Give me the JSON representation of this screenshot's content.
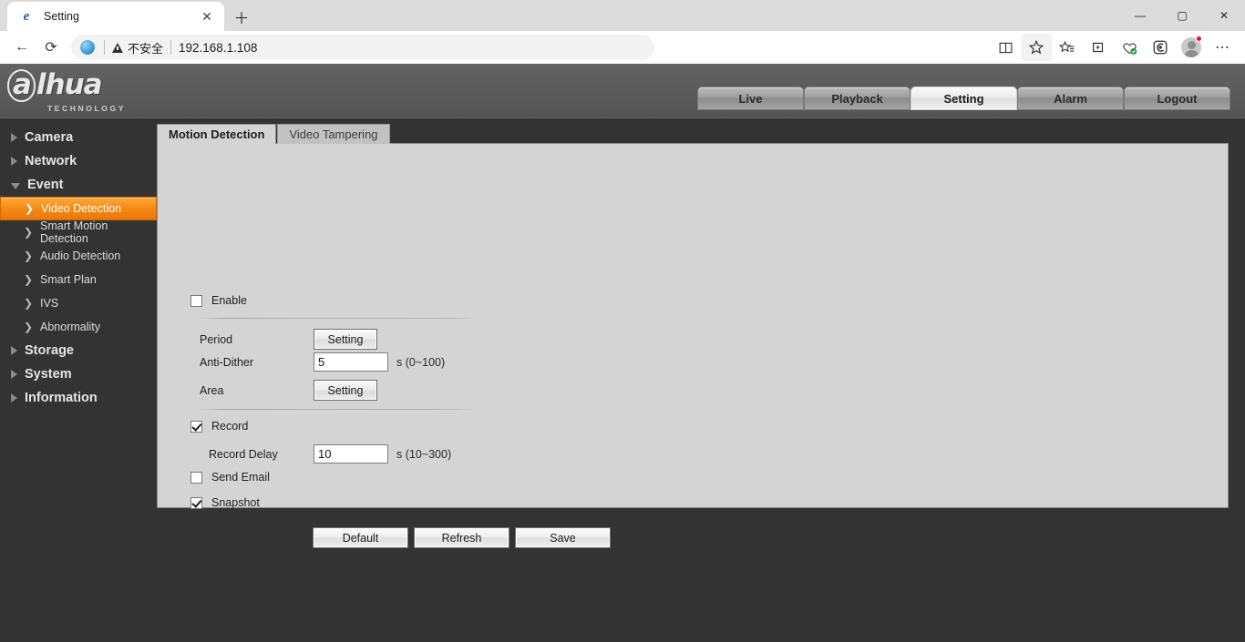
{
  "browser": {
    "tab": {
      "title": "Setting",
      "favicon_icon": "edge-e-icon",
      "close_icon": "✕"
    },
    "newtab_icon": "＋",
    "nav": {
      "back_icon": "←",
      "reload_icon": "⟳"
    },
    "address": {
      "globe_icon": "globe-icon",
      "security_label": "不安全",
      "url": "192.168.1.108"
    },
    "toolbar_icons": [
      {
        "name": "split-screen-icon",
        "glyph": "▯▯"
      },
      {
        "name": "favorite-star-icon",
        "glyph": "☆"
      },
      {
        "name": "favorites-list-icon",
        "glyph": "☆"
      },
      {
        "name": "collections-icon",
        "glyph": "▣"
      },
      {
        "name": "browser-essentials-icon",
        "glyph": "♡"
      },
      {
        "name": "copilot-icon",
        "glyph": "◉"
      }
    ],
    "more_icon": "⋯",
    "window": {
      "minimize": "—",
      "maximize": "▢",
      "close": "✕"
    }
  },
  "device": {
    "logo": {
      "brand": "alhua",
      "brand_a": "a",
      "brand_rest": "lhua",
      "tagline": "TECHNOLOGY"
    },
    "topnav": [
      {
        "label": "Live",
        "active": false
      },
      {
        "label": "Playback",
        "active": false
      },
      {
        "label": "Setting",
        "active": true
      },
      {
        "label": "Alarm",
        "active": false
      },
      {
        "label": "Logout",
        "active": false
      }
    ],
    "sidebar": [
      {
        "label": "Camera",
        "type": "top",
        "expanded": false
      },
      {
        "label": "Network",
        "type": "top",
        "expanded": false
      },
      {
        "label": "Event",
        "type": "top",
        "expanded": true
      },
      {
        "label": "Video Detection",
        "type": "sub",
        "active": true
      },
      {
        "label": "Smart Motion Detection",
        "type": "sub",
        "active": false
      },
      {
        "label": "Audio Detection",
        "type": "sub",
        "active": false
      },
      {
        "label": "Smart Plan",
        "type": "sub",
        "active": false
      },
      {
        "label": "IVS",
        "type": "sub",
        "active": false
      },
      {
        "label": "Abnormality",
        "type": "sub",
        "active": false
      },
      {
        "label": "Storage",
        "type": "top",
        "expanded": false
      },
      {
        "label": "System",
        "type": "top",
        "expanded": false
      },
      {
        "label": "Information",
        "type": "top",
        "expanded": false
      }
    ],
    "tabs": [
      {
        "label": "Motion Detection",
        "active": true
      },
      {
        "label": "Video Tampering",
        "active": false
      }
    ],
    "form": {
      "enable": {
        "label": "Enable",
        "checked": false
      },
      "period": {
        "label": "Period",
        "button": "Setting"
      },
      "anti_dither": {
        "label": "Anti-Dither",
        "value": "5",
        "hint": "s (0~100)"
      },
      "area": {
        "label": "Area",
        "button": "Setting"
      },
      "record": {
        "label": "Record",
        "checked": true
      },
      "record_delay": {
        "label": "Record Delay",
        "value": "10",
        "hint": "s (10~300)"
      },
      "send_email": {
        "label": "Send Email",
        "checked": false
      },
      "snapshot": {
        "label": "Snapshot",
        "checked": true
      },
      "actions": [
        {
          "label": "Default"
        },
        {
          "label": "Refresh"
        },
        {
          "label": "Save"
        }
      ]
    }
  },
  "colors": {
    "accent_orange": "#f58a14",
    "panel_bg": "#d4d4d4",
    "header_bg": "#5b5b5b",
    "body_bg": "#333333"
  }
}
